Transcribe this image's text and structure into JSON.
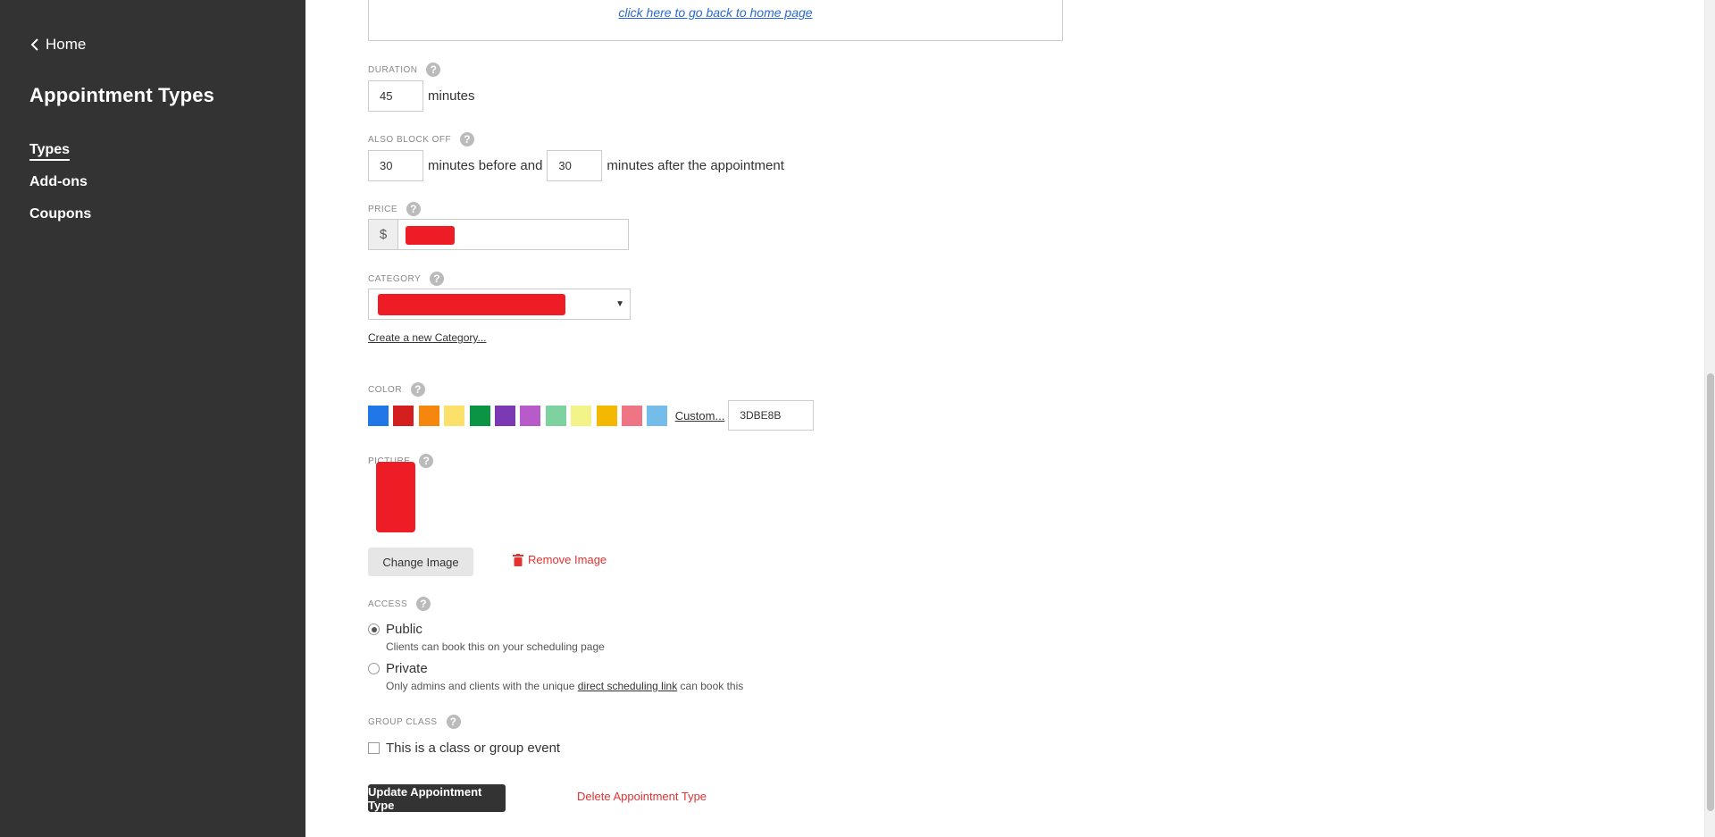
{
  "sidebar": {
    "home_label": "Home",
    "title": "Appointment Types",
    "items": [
      {
        "label": "Types",
        "active": true
      },
      {
        "label": "Add-ons",
        "active": false
      },
      {
        "label": "Coupons",
        "active": false
      }
    ]
  },
  "main": {
    "back_link": "click here to go back to home page",
    "duration": {
      "label": "DURATION",
      "value": "45",
      "unit": "minutes"
    },
    "block_off": {
      "label": "ALSO BLOCK OFF",
      "before_value": "30",
      "before_text": "minutes before and",
      "after_value": "30",
      "after_text": "minutes after the appointment"
    },
    "price": {
      "label": "PRICE",
      "currency": "$"
    },
    "category": {
      "label": "CATEGORY",
      "create_link": "Create a new Category..."
    },
    "color": {
      "label": "COLOR",
      "swatches": [
        "#2176e8",
        "#d41f1f",
        "#f5870e",
        "#fbe06a",
        "#0c9445",
        "#7b39b4",
        "#b65bc9",
        "#7ed2a0",
        "#f2f48a",
        "#f5b800",
        "#ef7585",
        "#74bcea"
      ],
      "custom_label": "Custom...",
      "hex_value": "3DBE8B"
    },
    "picture": {
      "label": "PICTURE",
      "change_label": "Change Image",
      "remove_label": "Remove Image"
    },
    "access": {
      "label": "ACCESS",
      "public_label": "Public",
      "public_desc": "Clients can book this on your scheduling page",
      "private_label": "Private",
      "private_desc_before": "Only admins and clients with the unique",
      "private_desc_link": "direct scheduling link",
      "private_desc_after": "can book this"
    },
    "group_class": {
      "label": "GROUP CLASS",
      "checkbox_label": "This is a class or group event"
    },
    "update_label": "Update Appointment Type",
    "delete_label": "Delete Appointment Type"
  },
  "colors": {
    "sidebar_bg": "#333333",
    "danger": "#e23232",
    "link": "#2a6acf",
    "redaction": "#ee1c24"
  }
}
